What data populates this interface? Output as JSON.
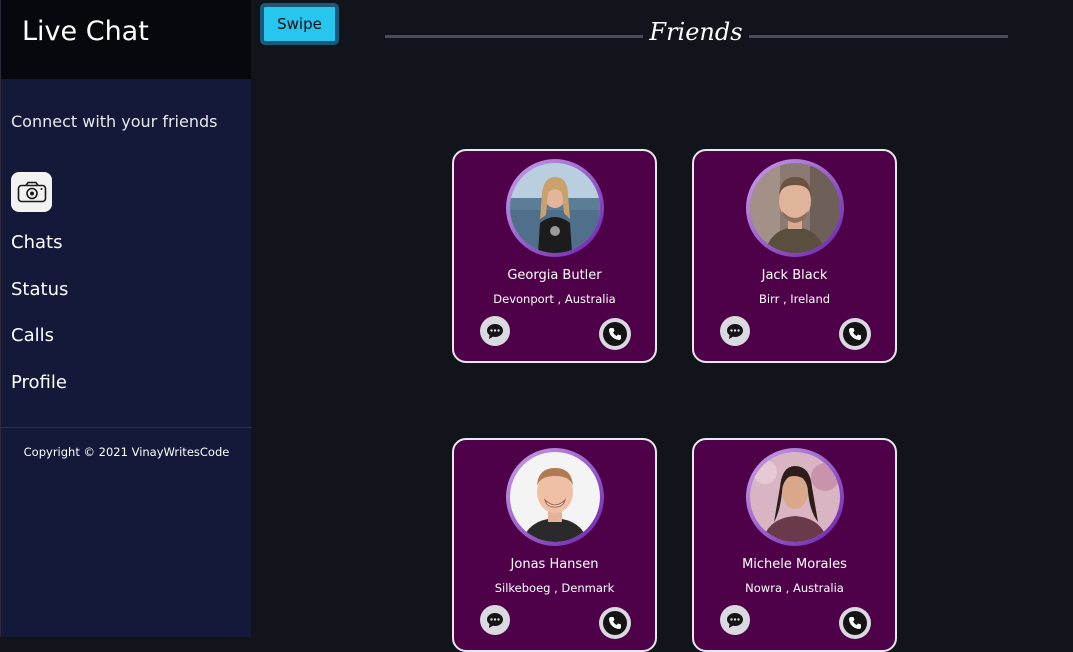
{
  "app": {
    "title": "Live Chat",
    "tagline": "Connect with your friends"
  },
  "sidebar": {
    "camera_icon": "camera-icon",
    "items": [
      {
        "label": "Chats"
      },
      {
        "label": "Status"
      },
      {
        "label": "Calls"
      },
      {
        "label": "Profile"
      }
    ],
    "copyright": "Copyright © 2021 VinayWritesCode"
  },
  "toolbar": {
    "swipe_label": "Swipe"
  },
  "main": {
    "heading": "Friends",
    "friends": [
      {
        "name": "Georgia Butler",
        "location": "Devonport , Australia"
      },
      {
        "name": "Jack Black",
        "location": "Birr , Ireland"
      },
      {
        "name": "Jonas Hansen",
        "location": "Silkeboeg , Denmark"
      },
      {
        "name": "Michele Morales",
        "location": "Nowra , Australia"
      }
    ]
  },
  "colors": {
    "sidebar_bg": "#14193a",
    "brand_bg": "#07080d",
    "page_bg": "#12141c",
    "card_bg": "#4e0048",
    "swipe_button": "#28c5ee",
    "avatar_ring": "#6a1fb0"
  }
}
